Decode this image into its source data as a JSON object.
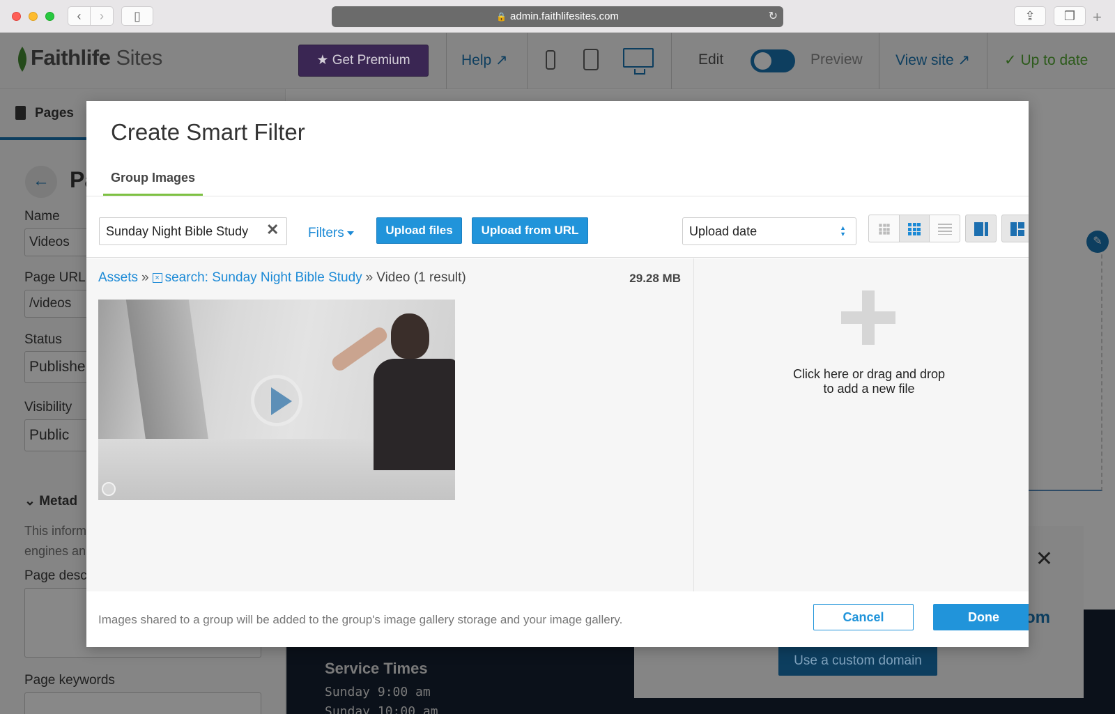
{
  "browser": {
    "url": "admin.faithlifesites.com"
  },
  "app_header": {
    "logo_brand": "Faithlife",
    "logo_product": "Sites",
    "premium_label": "Get Premium",
    "help_label": "Help",
    "edit_label": "Edit",
    "preview_label": "Preview",
    "view_site_label": "View site",
    "status_label": "Up to date"
  },
  "left_panel": {
    "tab_label": "Pages",
    "page_title_partial": "Pa",
    "name_label": "Name",
    "name_value": "Videos",
    "url_label": "Page URL",
    "url_value": "/videos",
    "status_label": "Status",
    "status_value": "Publishe",
    "visibility_label": "Visibility",
    "visibility_value": "Public",
    "metadata_heading": "Metad",
    "help_text_line1": "This inform",
    "help_text_line2": "engines an",
    "description_label": "Page descr",
    "keywords_label": "Page keywords"
  },
  "canvas": {
    "service_title": "Service Times",
    "service_lines": [
      "Sunday 9:00 am",
      "Sunday 10:00 am"
    ],
    "domain_partial": "om",
    "custom_domain_label": "Use a custom domain"
  },
  "modal": {
    "title": "Create Smart Filter",
    "tab_label": "Group Images",
    "search_value": "Sunday Night Bible Study",
    "filters_label": "Filters",
    "upload_files_label": "Upload files",
    "upload_url_label": "Upload from URL",
    "sort_value": "Upload date",
    "breadcrumb": {
      "root": "Assets",
      "search": "search: Sunday Night Bible Study",
      "type": "Video",
      "count": "(1 result)"
    },
    "total_size": "29.28 MB",
    "dropzone_line1": "Click here or drag and drop",
    "dropzone_line2": "to add a new file",
    "footer_note": "Images shared to a group will be added to the group's image gallery storage and your image gallery.",
    "cancel_label": "Cancel",
    "done_label": "Done"
  },
  "colors": {
    "accent_blue": "#2194da",
    "tab_underline_green": "#7dc142",
    "premium_purple": "#3a2653"
  }
}
